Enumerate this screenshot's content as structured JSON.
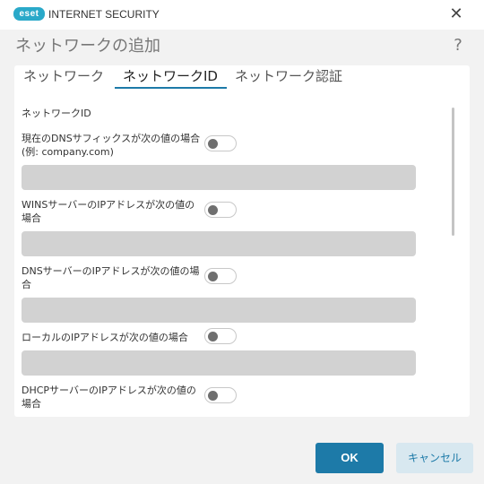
{
  "window": {
    "brand": "eset",
    "product": "INTERNET SECURITY",
    "close_glyph": "✕"
  },
  "dialog": {
    "title": "ネットワークの追加",
    "help_glyph": "?"
  },
  "tabs": [
    {
      "label": "ネットワーク",
      "active": false
    },
    {
      "label": "ネットワークID",
      "active": true
    },
    {
      "label": "ネットワーク認証",
      "active": false
    }
  ],
  "section": {
    "title": "ネットワークID"
  },
  "fields": [
    {
      "label": "現在のDNSサフィックスが次の値の場合\n(例: company.com)",
      "enabled": false,
      "value": "",
      "placeholder": ""
    },
    {
      "label": "WINSサーバーのIPアドレスが次の値の場合",
      "enabled": false,
      "value": "",
      "placeholder": ""
    },
    {
      "label": "DNSサーバーのIPアドレスが次の値の場合",
      "enabled": false,
      "value": "",
      "placeholder": ""
    },
    {
      "label": "ローカルのIPアドレスが次の値の場合",
      "enabled": false,
      "value": "",
      "placeholder": ""
    },
    {
      "label": "DHCPサーバーのIPアドレスが次の値の場合",
      "enabled": false
    }
  ],
  "buttons": {
    "ok": "OK",
    "cancel": "キャンセル"
  },
  "colors": {
    "accent": "#1d7aa8",
    "brand": "#2aa9c9",
    "field_bg": "#d2d2d2",
    "window_bg": "#f2f2f2"
  }
}
